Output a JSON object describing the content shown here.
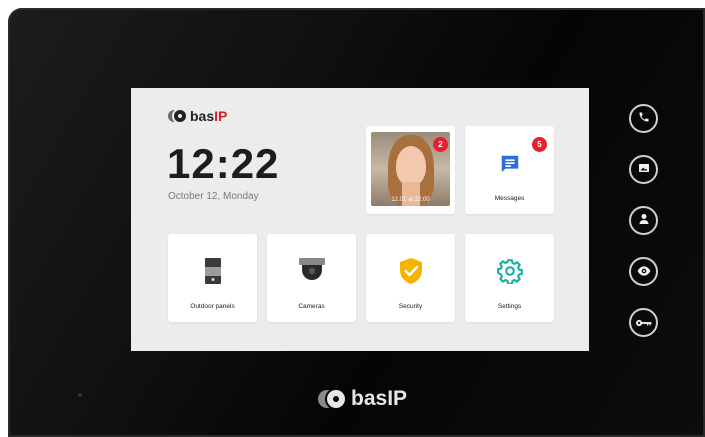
{
  "brand": {
    "name_prefix": "bas",
    "name_suffix": "IP"
  },
  "home": {
    "time": "12:22",
    "date": "October 12, Monday"
  },
  "tiles": {
    "intercom_call": {
      "timestamp": "12.01 at 22:00",
      "badge": "2"
    },
    "messages": {
      "label": "Messages",
      "badge": "5"
    },
    "outdoor_panels": {
      "label": "Outdoor panels"
    },
    "cameras": {
      "label": "Cameras"
    },
    "security": {
      "label": "Security"
    },
    "settings": {
      "label": "Settings"
    }
  },
  "side_buttons": [
    "phone-icon",
    "gallery-icon",
    "user-icon",
    "eye-icon",
    "key-icon"
  ],
  "colors": {
    "accent_red": "#e8202e",
    "messages_blue": "#2d6fd6",
    "security_yellow": "#f4b400",
    "settings_teal": "#19b3a6"
  }
}
